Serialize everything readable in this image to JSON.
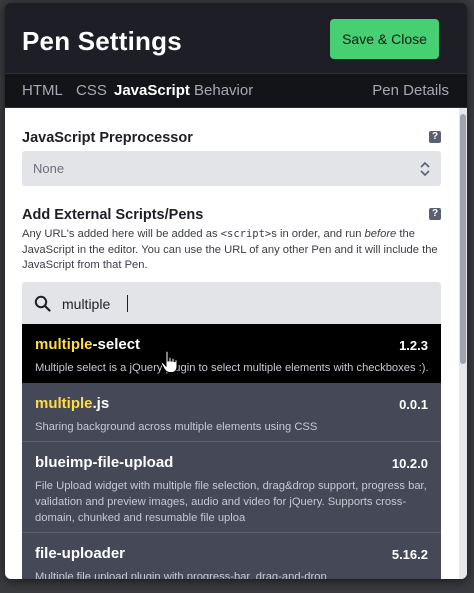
{
  "header": {
    "title": "Pen Settings",
    "save_label": "Save & Close",
    "accent_color": "#47cf73"
  },
  "tabs": [
    {
      "label": "HTML",
      "active": false
    },
    {
      "label": "CSS",
      "active": false
    },
    {
      "label": "JavaScript",
      "active": true
    },
    {
      "label": "Behavior",
      "active": false
    }
  ],
  "pen_details_label": "Pen Details",
  "preprocessor": {
    "label": "JavaScript Preprocessor",
    "help": "?",
    "value": "None"
  },
  "external": {
    "label": "Add External Scripts/Pens",
    "help": "?",
    "desc_part1": "Any URL's added here will be added as ",
    "desc_code": "<script>",
    "desc_part2": "s in order, and run ",
    "desc_em": "before",
    "desc_part3": " the JavaScript in the editor. You can use the URL of any other Pen and it will include the JavaScript from that Pen."
  },
  "search": {
    "value": "multiple",
    "icon": "search-icon"
  },
  "results": [
    {
      "name_match": "multiple",
      "name_rest": "-select",
      "version": "1.2.3",
      "description": "Multiple select is a jQuery plugin to select multiple elements with checkboxes :).",
      "highlighted": true
    },
    {
      "name_match": "multiple",
      "name_rest": ".js",
      "version": "0.0.1",
      "description": "Sharing background across multiple elements using CSS",
      "highlighted": false
    },
    {
      "name_match": "",
      "name_rest": "blueimp-file-upload",
      "version": "10.2.0",
      "description": "File Upload widget with multiple file selection, drag&drop support, progress bar, validation and preview images, audio and video for jQuery. Supports cross-domain, chunked and resumable file uploa",
      "highlighted": false
    },
    {
      "name_match": "",
      "name_rest": "file-uploader",
      "version": "5.16.2",
      "description": "Multiple file upload plugin with progress-bar, drag-and-drop",
      "highlighted": false
    }
  ]
}
